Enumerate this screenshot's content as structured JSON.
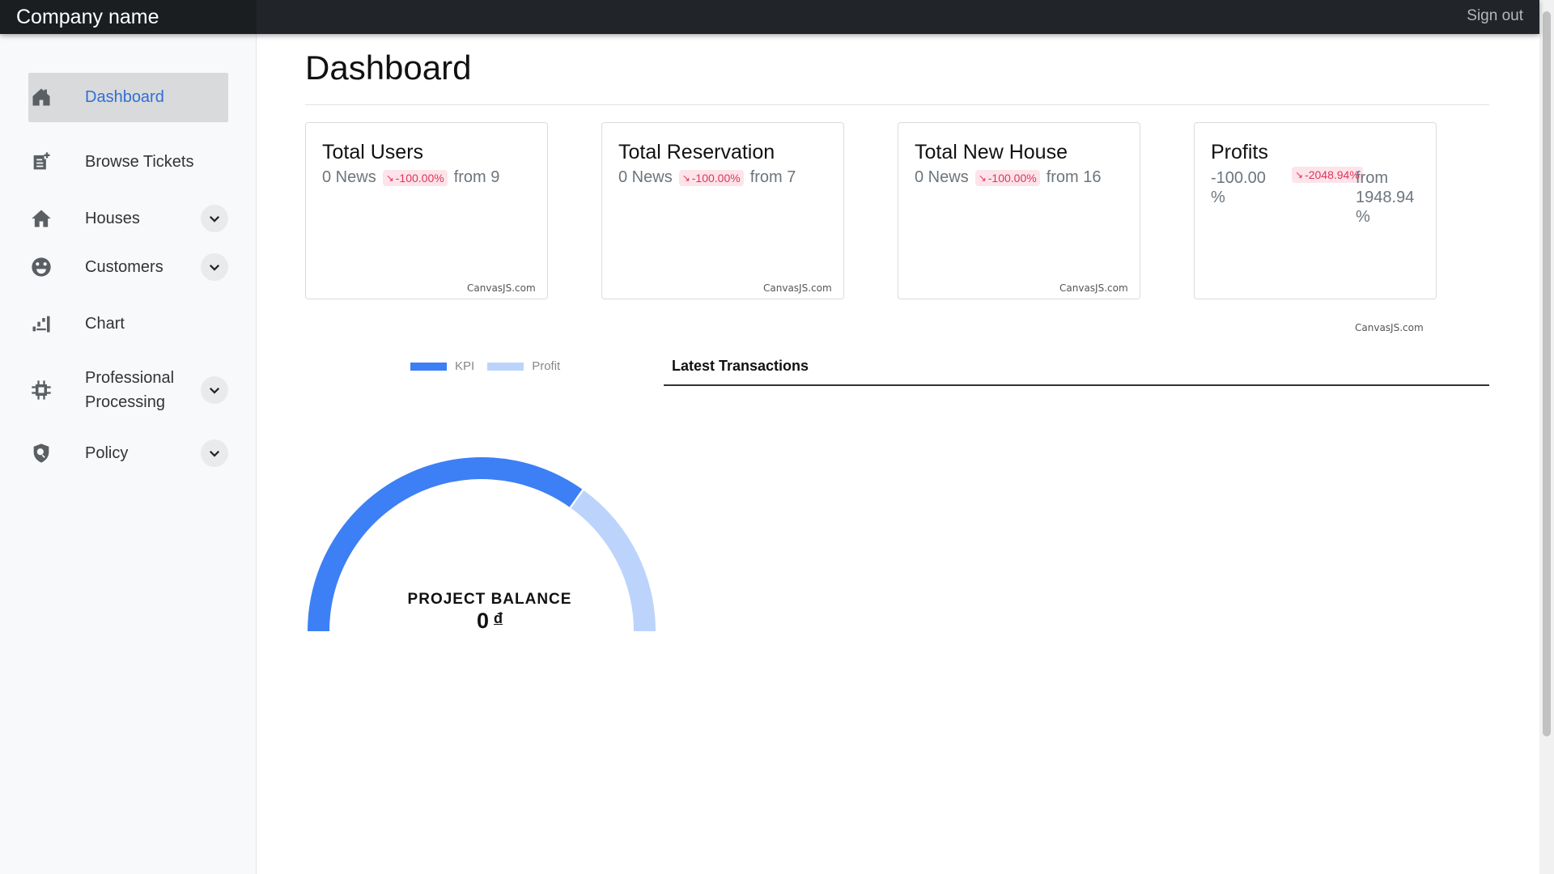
{
  "navbar": {
    "brand": "Company name",
    "signout": "Sign out"
  },
  "sidebar": {
    "items": [
      {
        "label": "Dashboard",
        "icon": "house-dashboard-icon",
        "active": true
      },
      {
        "label": "Browse Tickets",
        "icon": "ticket-add-icon"
      },
      {
        "label": "Houses",
        "icon": "home-icon",
        "expandable": true
      },
      {
        "label": "Customers",
        "icon": "palette-icon",
        "expandable": true
      },
      {
        "label": "Chart",
        "icon": "chart-icon"
      },
      {
        "label": "Professional Processing",
        "label_line1": "Professional",
        "label_line2": "Processing",
        "icon": "chip-icon",
        "expandable": true
      },
      {
        "label": "Policy",
        "icon": "shield-search-icon",
        "expandable": true
      }
    ]
  },
  "main": {
    "title": "Dashboard",
    "cards": [
      {
        "title": "Total Users",
        "value": "0 News",
        "change": "-100.00%",
        "from": "from 9",
        "credit": "CanvasJS.com"
      },
      {
        "title": "Total Reservation",
        "value": "0 News",
        "change": "-100.00%",
        "from": "from 7",
        "credit": "CanvasJS.com"
      },
      {
        "title": "Total New House",
        "value": "0 News",
        "change": "-100.00%",
        "from": "from 16",
        "credit": "CanvasJS.com"
      },
      {
        "title": "Profits",
        "value_line1": "-100.00",
        "value_line2": "%",
        "change": "-2048.94%",
        "from_line1": "from",
        "from_line2": "1948.94",
        "from_line3": "%",
        "credit": "CanvasJS.com"
      }
    ],
    "gauge": {
      "legend": [
        {
          "name": "KPI",
          "color": "#3d7ff5"
        },
        {
          "name": "Profit",
          "color": "#bcd4fb"
        }
      ],
      "title": "PROJECT BALANCE",
      "value": "0",
      "currency": "đ"
    },
    "transactions": {
      "tab": "Latest Transactions"
    }
  },
  "chart_data": {
    "type": "pie",
    "series": [
      {
        "name": "KPI",
        "value": 0.7
      },
      {
        "name": "Profit",
        "value": 0.3
      }
    ],
    "title": "PROJECT BALANCE"
  },
  "colors": {
    "accent": "#3d7ff5",
    "accent_light": "#bcd4fb",
    "navbar": "#212529",
    "badge_bg": "#fce4ea",
    "badge_text": "#e0345a"
  }
}
